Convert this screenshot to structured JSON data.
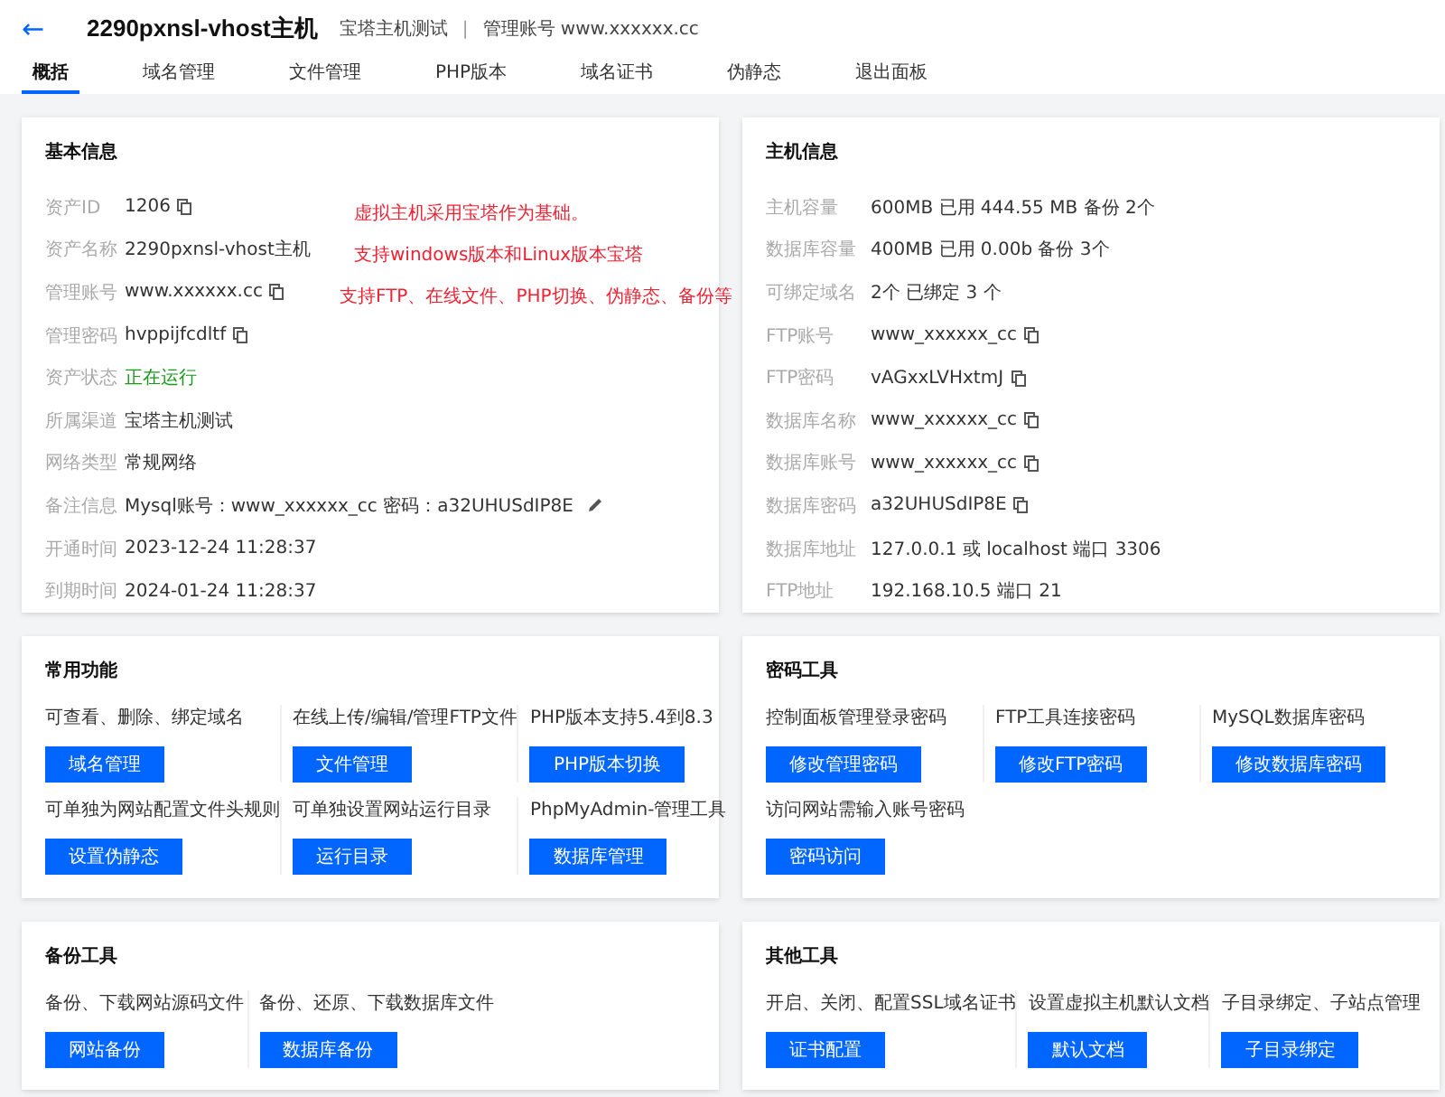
{
  "header": {
    "back": "←",
    "title": "2290pxnsl-vhost主机",
    "subtitle": "宝塔主机测试",
    "separator": "|",
    "account": "管理账号 www.xxxxxx.cc"
  },
  "tabs": [
    {
      "label": "概括",
      "selected": true
    },
    {
      "label": "域名管理",
      "selected": false
    },
    {
      "label": "文件管理",
      "selected": false
    },
    {
      "label": "PHP版本",
      "selected": false
    },
    {
      "label": "域名证书",
      "selected": false
    },
    {
      "label": "伪静态",
      "selected": false
    },
    {
      "label": "退出面板",
      "selected": false
    }
  ],
  "basic_info": {
    "title": "基本信息",
    "rows": [
      {
        "label": "资产ID",
        "value": "1206",
        "kind": "copy"
      },
      {
        "label": "资产名称",
        "value": "2290pxnsl-vhost主机",
        "kind": "plain"
      },
      {
        "label": "管理账号",
        "value": "www.xxxxxx.cc",
        "kind": "copy"
      },
      {
        "label": "管理密码",
        "value": "hvppijfcdltf",
        "kind": "copy"
      },
      {
        "label": "资产状态",
        "value": "正在运行",
        "kind": "status"
      },
      {
        "label": "所属渠道",
        "value": "宝塔主机测试",
        "kind": "plain"
      },
      {
        "label": "网络类型",
        "value": "常规网络",
        "kind": "plain"
      },
      {
        "label": "备注信息",
        "value": "Mysql账号：www_xxxxxx_cc 密码：a32UHUSdIP8E",
        "kind": "edit"
      },
      {
        "label": "开通时间",
        "value": "2023-12-24 11:28:37",
        "kind": "plain"
      },
      {
        "label": "到期时间",
        "value": "2024-01-24 11:28:37",
        "kind": "plain"
      }
    ],
    "annotations": [
      "虚拟主机采用宝塔作为基础。",
      "支持windows版本和Linux版本宝塔",
      "支持FTP、在线文件、PHP切换、伪静态、备份等"
    ]
  },
  "host_info": {
    "title": "主机信息",
    "rows": [
      {
        "label": "主机容量",
        "value": "600MB 已用 444.55 MB 备份 2个",
        "kind": "plain"
      },
      {
        "label": "数据库容量",
        "value": "400MB 已用 0.00b 备份 3个",
        "kind": "plain"
      },
      {
        "label": "可绑定域名",
        "value": "2个 已绑定 3 个",
        "kind": "plain"
      },
      {
        "label": "FTP账号",
        "value": "www_xxxxxx_cc",
        "kind": "copy"
      },
      {
        "label": "FTP密码",
        "value": "vAGxxLVHxtmJ",
        "kind": "copy"
      },
      {
        "label": "数据库名称",
        "value": "www_xxxxxx_cc",
        "kind": "copy"
      },
      {
        "label": "数据库账号",
        "value": "www_xxxxxx_cc",
        "kind": "copy"
      },
      {
        "label": "数据库密码",
        "value": "a32UHUSdIP8E",
        "kind": "copy"
      },
      {
        "label": "数据库地址",
        "value": "127.0.0.1 或 localhost 端口 3306",
        "kind": "plain"
      },
      {
        "label": "FTP地址",
        "value": "192.168.10.5 端口 21",
        "kind": "plain"
      }
    ]
  },
  "tool_cards": [
    {
      "title": "常用功能",
      "items": [
        {
          "description": "可查看、删除、绑定域名",
          "button": "域名管理"
        },
        {
          "description": "在线上传/编辑/管理FTP文件",
          "button": "文件管理"
        },
        {
          "description": "PHP版本支持5.4到8.3",
          "button": "PHP版本切换"
        },
        {
          "description": "可单独为网站配置文件头规则",
          "button": "设置伪静态"
        },
        {
          "description": "可单独设置网站运行目录",
          "button": "运行目录"
        },
        {
          "description": "PhpMyAdmin-管理工具",
          "button": "数据库管理"
        }
      ]
    },
    {
      "title": "密码工具",
      "items": [
        {
          "description": "控制面板管理登录密码",
          "button": "修改管理密码"
        },
        {
          "description": "FTP工具连接密码",
          "button": "修改FTP密码"
        },
        {
          "description": "MySQL数据库密码",
          "button": "修改数据库密码"
        },
        {
          "description": "访问网站需输入账号密码",
          "button": "密码访问"
        }
      ]
    },
    {
      "title": "备份工具",
      "items": [
        {
          "description": "备份、下载网站源码文件",
          "button": "网站备份"
        },
        {
          "description": "备份、还原、下载数据库文件",
          "button": "数据库备份"
        }
      ]
    },
    {
      "title": "其他工具",
      "items": [
        {
          "description": "开启、关闭、配置SSL域名证书",
          "button": "证书配置"
        },
        {
          "description": "设置虚拟主机默认文档",
          "button": "默认文档"
        },
        {
          "description": "子目录绑定、子站点管理",
          "button": "子目录绑定"
        }
      ]
    }
  ]
}
